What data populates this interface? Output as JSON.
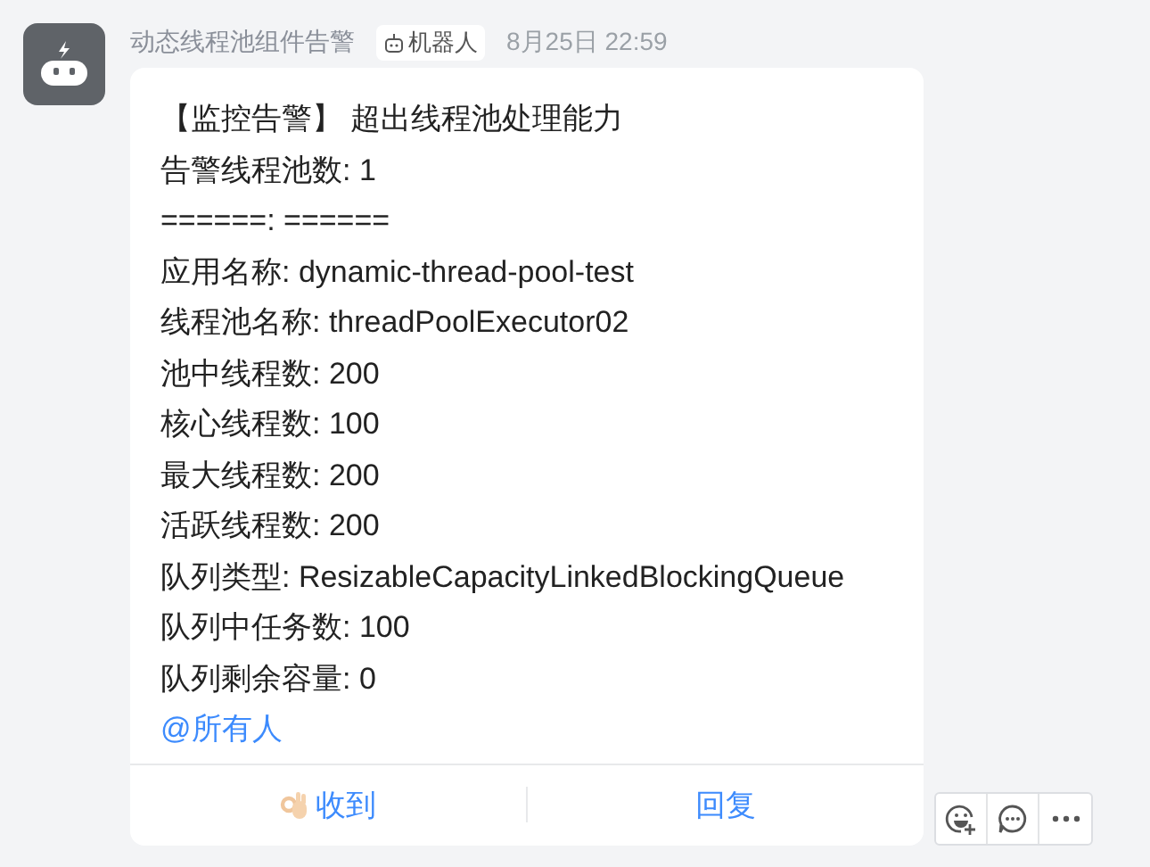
{
  "sender": {
    "name": "动态线程池组件告警",
    "badge": "机器人",
    "time": "8月25日 22:59"
  },
  "message": {
    "lines": [
      "【监控告警】 超出线程池处理能力",
      "告警线程池数: 1",
      "======: ======",
      "应用名称: dynamic-thread-pool-test",
      "线程池名称: threadPoolExecutor02",
      "池中线程数: 200",
      "核心线程数: 100",
      "最大线程数: 200",
      "活跃线程数: 200",
      "队列类型: ResizableCapacityLinkedBlockingQueue",
      "队列中任务数: 100",
      "队列剩余容量: 0"
    ],
    "mention": "@所有人"
  },
  "actions": [
    {
      "label": "收到",
      "kind": "emoji"
    },
    {
      "label": "回复",
      "kind": "plain"
    }
  ]
}
